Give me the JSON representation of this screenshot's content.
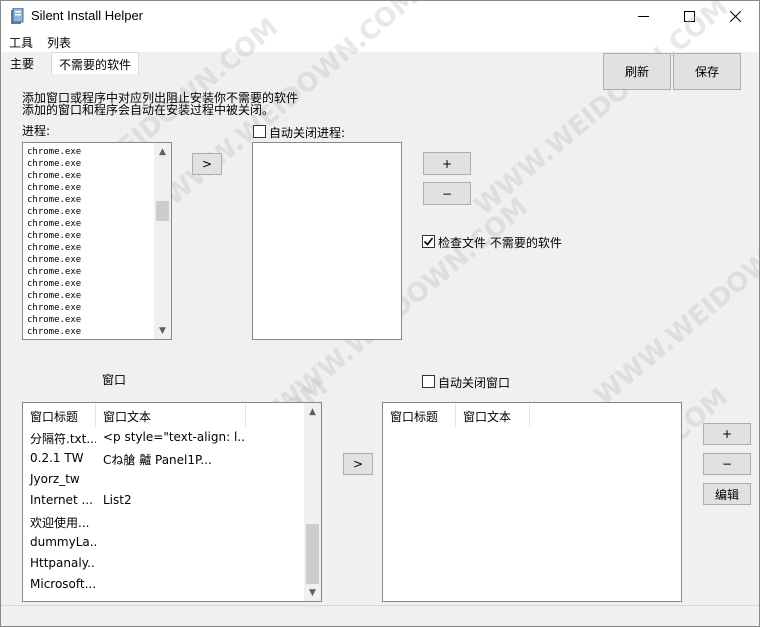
{
  "window": {
    "title": "Silent Install Helper"
  },
  "menu": [
    "工具",
    "列表"
  ],
  "tabs": [
    {
      "label": "主要",
      "active": false
    },
    {
      "label": "不需要的软件",
      "active": true
    }
  ],
  "toolbar": {
    "refresh_label": "刷新",
    "save_label": "保存"
  },
  "description": {
    "line1": "添加窗口或程序中对应列出阻止安装你不需要的软件",
    "line2": "添加的窗口和程序会自动在安装过程中被关闭。"
  },
  "process": {
    "label": "进程:",
    "items": [
      "chrome.exe",
      "chrome.exe",
      "chrome.exe",
      "chrome.exe",
      "chrome.exe",
      "chrome.exe",
      "chrome.exe",
      "chrome.exe",
      "chrome.exe",
      "chrome.exe",
      "chrome.exe",
      "chrome.exe",
      "chrome.exe",
      "chrome.exe",
      "chrome.exe",
      "chrome.exe"
    ],
    "move_label": ">"
  },
  "auto_close_process": {
    "label": "自动关闭进程:",
    "checked": false
  },
  "process_controls": {
    "add_label": "+",
    "remove_label": "−"
  },
  "check_file": {
    "label": "检查文件  不需要的软件",
    "checked": true
  },
  "window_section": {
    "label": "窗口",
    "columns": [
      "窗口标题",
      "窗口文本"
    ],
    "rows": [
      {
        "title": "分隔符.txt...",
        "text": "<p style=\"text-align: l..."
      },
      {
        "title": "0.2.1 TW",
        "text": "Cね艙    齇        Panel1P..."
      },
      {
        "title": "Jyorz_tw",
        "text": ""
      },
      {
        "title": "Internet ...",
        "text": "List2"
      },
      {
        "title": "欢迎使用...",
        "text": ""
      },
      {
        "title": "dummyLa...",
        "text": ""
      },
      {
        "title": "Httpanaly...",
        "text": ""
      },
      {
        "title": "Microsoft...",
        "text": ""
      }
    ],
    "move_label": ">"
  },
  "auto_close_window": {
    "label": "自动关闭窗口",
    "checked": false,
    "columns": [
      "窗口标题",
      "窗口文本"
    ]
  },
  "window_controls": {
    "add_label": "+",
    "remove_label": "−",
    "edit_label": "编辑"
  },
  "watermark": "WWW.WEIDOWN.COM"
}
